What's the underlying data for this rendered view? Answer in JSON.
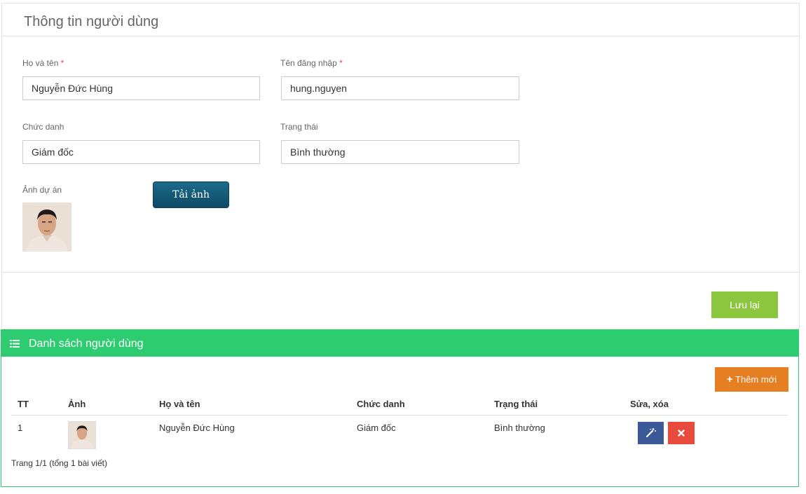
{
  "form": {
    "title": "Thông tin người dùng",
    "fullname_label": "Họ và tên",
    "fullname_value": "Nguyễn Đức Hùng",
    "username_label": "Tên đăng nhập",
    "username_value": "hung.nguyen",
    "required_mark": "*",
    "position_label": "Chức danh",
    "position_value": "Giám đốc",
    "status_label": "Trạng thái",
    "status_value": "Bình thường",
    "photo_label": "Ảnh dự án",
    "upload_label": "Tải ảnh",
    "save_label": "Lưu lại"
  },
  "list": {
    "title": "Danh sách người dùng",
    "add_label": "Thêm mới",
    "add_icon": "+",
    "columns": [
      "TT",
      "Ảnh",
      "Họ và tên",
      "Chức danh",
      "Trạng thái",
      "Sửa, xóa"
    ],
    "rows": [
      {
        "index": "1",
        "name": "Nguyễn Đức Hùng",
        "position": "Giám đốc",
        "status": "Bình thường"
      }
    ],
    "pagination": "Trang 1/1 (tổng 1 bài viết)"
  },
  "icons": {
    "list_header": "list-icon",
    "edit": "magic-wand-icon",
    "delete": "close-icon",
    "add": "plus-icon"
  },
  "colors": {
    "list_header_bg": "#2ecc71",
    "save_button": "#8cc63f",
    "add_button": "#e67e22",
    "edit_button": "#3b5998",
    "delete_button": "#e84b3c",
    "upload_button": "#0d4a66"
  }
}
